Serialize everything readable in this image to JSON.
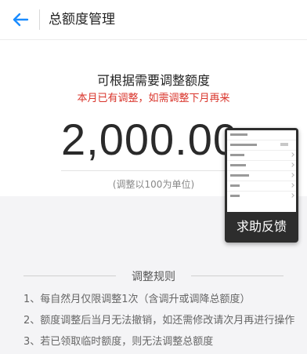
{
  "header": {
    "back_icon": "arrow-left-icon",
    "title": "总额度管理",
    "accent": "#1a8cff"
  },
  "main": {
    "headline": "可根据需要调整额度",
    "warning": "本月已有调整，如需调整下月再来",
    "warning_color": "#d9342b",
    "amount": "2,000.00",
    "unit_hint": "(调整以100为单位)"
  },
  "help_float": {
    "label": "求助反馈"
  },
  "rules": {
    "title": "调整规则",
    "items": [
      "1、每自然月仅限调整1次（含调升或调降总额度）",
      "2、额度调整后当月无法撤销，如还需修改请次月再进行操作",
      "3、若已领取临时额度，则无法调整总额度"
    ]
  }
}
